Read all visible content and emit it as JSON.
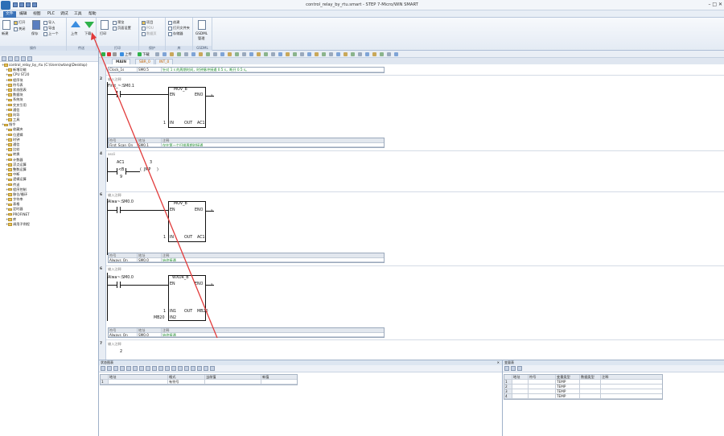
{
  "window": {
    "title": "control_relay_by_rtu.smart - STEP 7-Micro/WIN SMART",
    "controls": "–  □  ✕"
  },
  "menu": {
    "tabs": [
      "文件",
      "编辑",
      "视图",
      "PLC",
      "调试",
      "工具",
      "帮助"
    ]
  },
  "ribbon": {
    "file_group": {
      "new": "新建",
      "open": "打开",
      "close": "关闭",
      "save": "保存",
      "import": "导入",
      "export": "导出",
      "previous": "上一个",
      "label": "操作"
    },
    "transfer_group": {
      "upload": "上传",
      "download": "下载",
      "label": "传送"
    },
    "print_group": {
      "print": "打印",
      "preview": "预览",
      "page_setup": "页面设置",
      "label": "打印"
    },
    "protect_group": {
      "project": "项目",
      "pou": "POU",
      "data_page": "数据页",
      "label": "保护"
    },
    "lib_group": {
      "create": "创建",
      "open_folder": "打开文件夹",
      "memory": "存储器",
      "label": "库"
    },
    "gsdml_group": {
      "gsdml": "GSDML",
      "manage": "管理",
      "label": "GSDML"
    }
  },
  "tree": {
    "items": [
      {
        "label": "control_relay_by_rtu (C:\\Users\\wtang\\Desktop)",
        "level": 0
      },
      {
        "label": "新增功能",
        "level": 1
      },
      {
        "label": "CPU ST20",
        "level": 1
      },
      {
        "label": "程序块",
        "level": 1
      },
      {
        "label": "符号表",
        "level": 1
      },
      {
        "label": "状态图表",
        "level": 1
      },
      {
        "label": "数据块",
        "level": 1
      },
      {
        "label": "系统块",
        "level": 1
      },
      {
        "label": "交叉引用",
        "level": 1
      },
      {
        "label": "通信",
        "level": 1
      },
      {
        "label": "向导",
        "level": 1
      },
      {
        "label": "工具",
        "level": 1
      },
      {
        "label": "指令",
        "level": 0
      },
      {
        "label": "收藏夹",
        "level": 1
      },
      {
        "label": "位逻辑",
        "level": 1
      },
      {
        "label": "时钟",
        "level": 1
      },
      {
        "label": "通信",
        "level": 1
      },
      {
        "label": "比较",
        "level": 1
      },
      {
        "label": "转换",
        "level": 1
      },
      {
        "label": "计数器",
        "level": 1
      },
      {
        "label": "浮点运算",
        "level": 1
      },
      {
        "label": "整数运算",
        "level": 1
      },
      {
        "label": "中断",
        "level": 1
      },
      {
        "label": "逻辑运算",
        "level": 1
      },
      {
        "label": "传送",
        "level": 1
      },
      {
        "label": "程序控制",
        "level": 1
      },
      {
        "label": "移位/循环",
        "level": 1
      },
      {
        "label": "字符串",
        "level": 1
      },
      {
        "label": "表格",
        "level": 1
      },
      {
        "label": "定时器",
        "level": 1
      },
      {
        "label": "PROFINET",
        "level": 1
      },
      {
        "label": "库",
        "level": 1
      },
      {
        "label": "调用子例程",
        "level": 1
      }
    ]
  },
  "editor": {
    "toolbar": {
      "upload": "上传",
      "download": "下载"
    },
    "tabs": [
      "MAIN",
      "SBR_0",
      "INT_0"
    ],
    "top_symbol": {
      "name": "Clock_1s",
      "addr": "SM0.5",
      "comment": "针对 1 s 的周期时间，时钟脉冲接通 0.5 s，断开 0.5 s。"
    },
    "rung2": {
      "num": "2",
      "comment": "输入注释",
      "contact": "First_~:SM0.1",
      "box": "MOV_B",
      "en": "EN",
      "eno": "ENO",
      "in_val": "1",
      "in": "IN",
      "out": "OUT",
      "out_val": "AC1",
      "sym_head": [
        "符号",
        "地址",
        "注释"
      ],
      "sym": [
        "First_Scan_On",
        "SM0.1",
        "仅在第一个扫描周期时接通"
      ]
    },
    "rung4": {
      "num": "4",
      "comment": "ascii",
      "op1": "AC1",
      "cmp": "<B",
      "op2": "9",
      "jmp_label": "3",
      "jmp": "JMP"
    },
    "rung6": {
      "num": "6",
      "comment": "输入注释",
      "contact": "Alwa~:SM0.0",
      "box": "MOV_B",
      "en": "EN",
      "eno": "ENO",
      "in_val": "1",
      "in": "IN",
      "out": "OUT",
      "out_val": "AC1",
      "sym_head": [
        "符号",
        "地址",
        "注释"
      ],
      "sym": [
        "Always_On",
        "SM0.0",
        "始终接通"
      ]
    },
    "rung_wxor": {
      "num": "6",
      "comment": "输入注释",
      "contact": "Alwa~:SM0.0",
      "box": "WXOR_B",
      "en": "EN",
      "eno": "ENO",
      "in1_val": "1",
      "in1": "IN1",
      "out": "OUT",
      "out_val": "MB20",
      "in2_val": "MB20",
      "in2": "IN2",
      "sym_head": [
        "符号",
        "地址",
        "注释"
      ],
      "sym": [
        "Always_On",
        "SM0.0",
        "始终接通"
      ]
    },
    "rung7": {
      "num": "7",
      "comment": "输入注释",
      "val": "2"
    }
  },
  "status_chart": {
    "title": "状态图表",
    "close": "✕",
    "cols": [
      "地址",
      "格式",
      "当前值",
      "新值"
    ],
    "row1_index": "1",
    "row1_format": "有符号"
  },
  "var_table": {
    "title": "变量表",
    "cols": [
      "地址",
      "符号",
      "变量类型",
      "数据类型",
      "注释"
    ],
    "rows": [
      {
        "idx": "1",
        "type": "TEMP"
      },
      {
        "idx": "2",
        "type": "TEMP"
      },
      {
        "idx": "3",
        "type": "TEMP"
      },
      {
        "idx": "4",
        "type": "TEMP"
      }
    ]
  },
  "colors": {
    "accent": "#3b73b9",
    "annotation": "#e23b3b",
    "upload": "#3b8ee0",
    "download": "#2fb24a"
  }
}
